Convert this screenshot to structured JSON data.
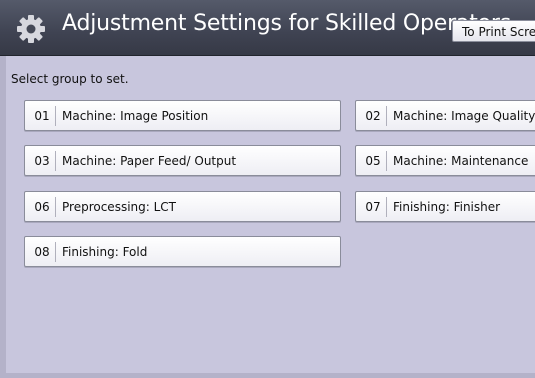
{
  "header": {
    "title": "Adjustment Settings for Skilled Operators",
    "print_button_label": "To Print Scre",
    "icon": "gear-icon"
  },
  "instruction": "Select group to set.",
  "groups": [
    {
      "num": "01",
      "label": "Machine: Image Position"
    },
    {
      "num": "02",
      "label": "Machine: Image Quality"
    },
    {
      "num": "03",
      "label": "Machine: Paper Feed/ Output"
    },
    {
      "num": "05",
      "label": "Machine: Maintenance"
    },
    {
      "num": "06",
      "label": "Preprocessing: LCT"
    },
    {
      "num": "07",
      "label": "Finishing: Finisher"
    },
    {
      "num": "08",
      "label": "Finishing: Fold"
    }
  ]
}
